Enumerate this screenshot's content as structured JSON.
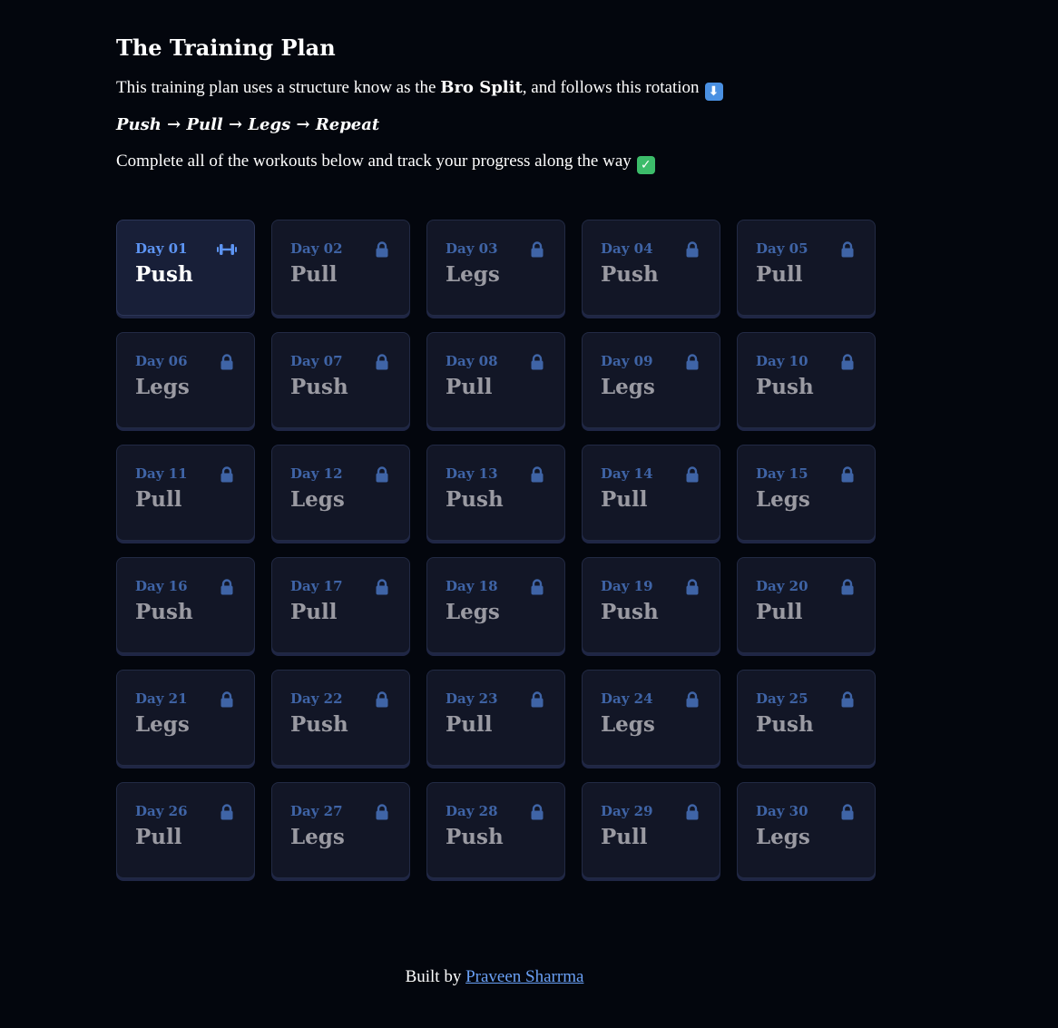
{
  "header": {
    "title": "The Training Plan",
    "intro_prefix": "This training plan uses a structure know as the ",
    "intro_bold": "Bro Split",
    "intro_suffix": ", and follows this rotation",
    "intro_emoji": "⬇",
    "rotation": "Push → Pull → Legs → Repeat",
    "progress_text": "Complete all of the workouts below and track your progress along the way",
    "progress_emoji": "✓"
  },
  "days": [
    {
      "day": "Day 01",
      "type": "Push",
      "status": "active",
      "icon": "dumbbell-icon"
    },
    {
      "day": "Day 02",
      "type": "Pull",
      "status": "locked",
      "icon": "lock-icon"
    },
    {
      "day": "Day 03",
      "type": "Legs",
      "status": "locked",
      "icon": "lock-icon"
    },
    {
      "day": "Day 04",
      "type": "Push",
      "status": "locked",
      "icon": "lock-icon"
    },
    {
      "day": "Day 05",
      "type": "Pull",
      "status": "locked",
      "icon": "lock-icon"
    },
    {
      "day": "Day 06",
      "type": "Legs",
      "status": "locked",
      "icon": "lock-icon"
    },
    {
      "day": "Day 07",
      "type": "Push",
      "status": "locked",
      "icon": "lock-icon"
    },
    {
      "day": "Day 08",
      "type": "Pull",
      "status": "locked",
      "icon": "lock-icon"
    },
    {
      "day": "Day 09",
      "type": "Legs",
      "status": "locked",
      "icon": "lock-icon"
    },
    {
      "day": "Day 10",
      "type": "Push",
      "status": "locked",
      "icon": "lock-icon"
    },
    {
      "day": "Day 11",
      "type": "Pull",
      "status": "locked",
      "icon": "lock-icon"
    },
    {
      "day": "Day 12",
      "type": "Legs",
      "status": "locked",
      "icon": "lock-icon"
    },
    {
      "day": "Day 13",
      "type": "Push",
      "status": "locked",
      "icon": "lock-icon"
    },
    {
      "day": "Day 14",
      "type": "Pull",
      "status": "locked",
      "icon": "lock-icon"
    },
    {
      "day": "Day 15",
      "type": "Legs",
      "status": "locked",
      "icon": "lock-icon"
    },
    {
      "day": "Day 16",
      "type": "Push",
      "status": "locked",
      "icon": "lock-icon"
    },
    {
      "day": "Day 17",
      "type": "Pull",
      "status": "locked",
      "icon": "lock-icon"
    },
    {
      "day": "Day 18",
      "type": "Legs",
      "status": "locked",
      "icon": "lock-icon"
    },
    {
      "day": "Day 19",
      "type": "Push",
      "status": "locked",
      "icon": "lock-icon"
    },
    {
      "day": "Day 20",
      "type": "Pull",
      "status": "locked",
      "icon": "lock-icon"
    },
    {
      "day": "Day 21",
      "type": "Legs",
      "status": "locked",
      "icon": "lock-icon"
    },
    {
      "day": "Day 22",
      "type": "Push",
      "status": "locked",
      "icon": "lock-icon"
    },
    {
      "day": "Day 23",
      "type": "Pull",
      "status": "locked",
      "icon": "lock-icon"
    },
    {
      "day": "Day 24",
      "type": "Legs",
      "status": "locked",
      "icon": "lock-icon"
    },
    {
      "day": "Day 25",
      "type": "Push",
      "status": "locked",
      "icon": "lock-icon"
    },
    {
      "day": "Day 26",
      "type": "Pull",
      "status": "locked",
      "icon": "lock-icon"
    },
    {
      "day": "Day 27",
      "type": "Legs",
      "status": "locked",
      "icon": "lock-icon"
    },
    {
      "day": "Day 28",
      "type": "Push",
      "status": "locked",
      "icon": "lock-icon"
    },
    {
      "day": "Day 29",
      "type": "Pull",
      "status": "locked",
      "icon": "lock-icon"
    },
    {
      "day": "Day 30",
      "type": "Legs",
      "status": "locked",
      "icon": "lock-icon"
    }
  ],
  "footer": {
    "prefix": "Built by ",
    "author": "Praveen Sharrma"
  },
  "colors": {
    "background": "#03060d",
    "card": "#121626",
    "card_active": "#181f38",
    "day_label": "#3f64a6",
    "day_label_active": "#5d94f2",
    "workout_locked": "#9a9aa2",
    "lock_icon": "#3f64a6",
    "link": "#6aa0f5"
  }
}
